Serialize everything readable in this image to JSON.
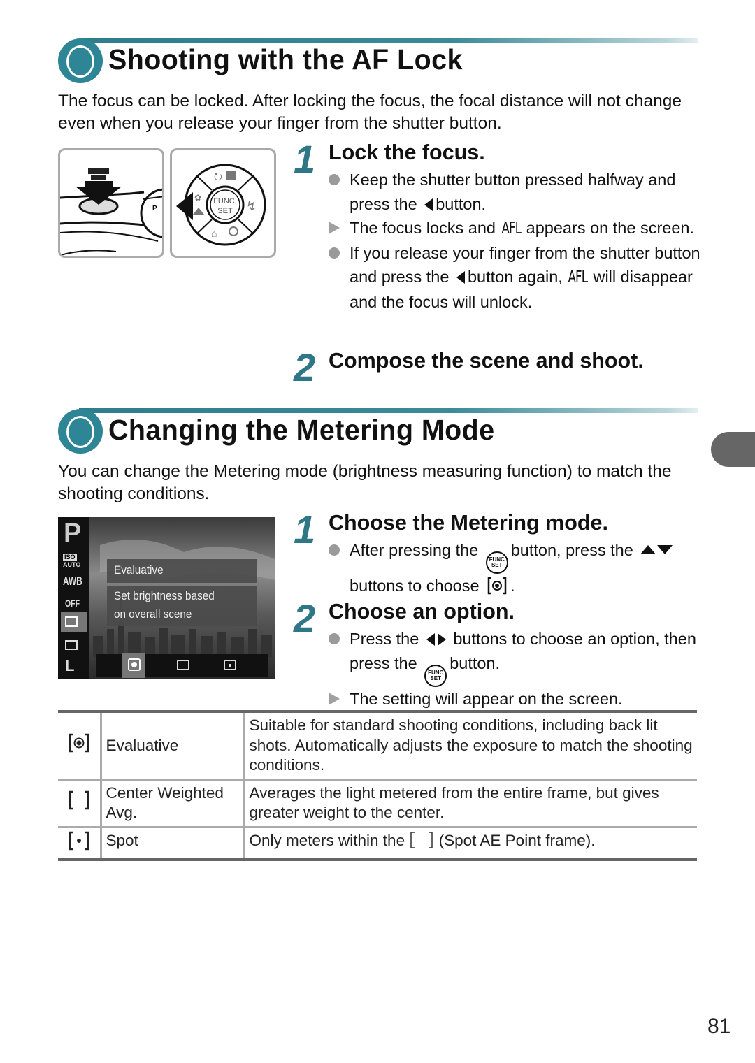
{
  "section1": {
    "title": "Shooting with the AF Lock",
    "intro": "The focus can be locked. After locking the focus, the focal distance will not change even when you release your finger from the shutter button.",
    "illustrations": {
      "shutter_icon": "shutter-button-press-illustration",
      "dial_labels": {
        "center_top": "FUNC.",
        "center_bottom": "SET"
      }
    },
    "steps": [
      {
        "num": "1",
        "title": "Lock the focus.",
        "bullets": [
          {
            "type": "dot",
            "parts": [
              "Keep the shutter button pressed halfway and press the",
              "button."
            ]
          },
          {
            "type": "arrow",
            "parts": [
              "The focus locks and",
              "AFL",
              "appears on the screen."
            ]
          },
          {
            "type": "dot",
            "parts": [
              "If you release your finger from the shutter button and press the",
              "button again,",
              "AFL",
              "will disappear and the focus will unlock."
            ]
          }
        ]
      },
      {
        "num": "2",
        "title": "Compose the scene and shoot."
      }
    ]
  },
  "section2": {
    "title": "Changing the Metering Mode",
    "intro": "You can change the Metering mode (brightness measuring function) to match the shooting conditions.",
    "lcd": {
      "mode": "P",
      "iso": "ISO",
      "iso_value": "AUTO",
      "wb": "AWB",
      "flash": "OFF",
      "quality": "L",
      "popup_title": "Evaluative",
      "popup_desc_1": "Set brightness based",
      "popup_desc_2": "on overall scene"
    },
    "steps": [
      {
        "num": "1",
        "title": "Choose the Metering mode.",
        "bullets": [
          {
            "type": "dot",
            "parts": [
              "After pressing the",
              "button, press the",
              "buttons to choose",
              "."
            ]
          }
        ]
      },
      {
        "num": "2",
        "title": "Choose an option.",
        "bullets": [
          {
            "type": "dot",
            "parts": [
              "Press the",
              "buttons to choose an option, then press the",
              "button."
            ]
          },
          {
            "type": "arrow",
            "parts": [
              "The setting will appear on the screen."
            ]
          }
        ]
      }
    ],
    "table": [
      {
        "icon": "evaluative-metering-icon",
        "name": "Evaluative",
        "desc": "Suitable for standard shooting conditions, including back lit shots. Automatically adjusts the exposure to match the shooting conditions."
      },
      {
        "icon": "center-weighted-metering-icon",
        "name": "Center Weighted Avg.",
        "desc": "Averages the light metered from the entire frame, but gives greater weight to the center."
      },
      {
        "icon": "spot-metering-icon",
        "name": "Spot",
        "desc_before": "Only meters within the",
        "desc_after": "(Spot AE Point frame)."
      }
    ]
  },
  "func_icon": {
    "top": "FUNC",
    "bottom": "SET"
  },
  "page_number": "81",
  "colors": {
    "accent": "#2e8596",
    "step_number": "#2f7786",
    "side_tab": "#666666"
  }
}
